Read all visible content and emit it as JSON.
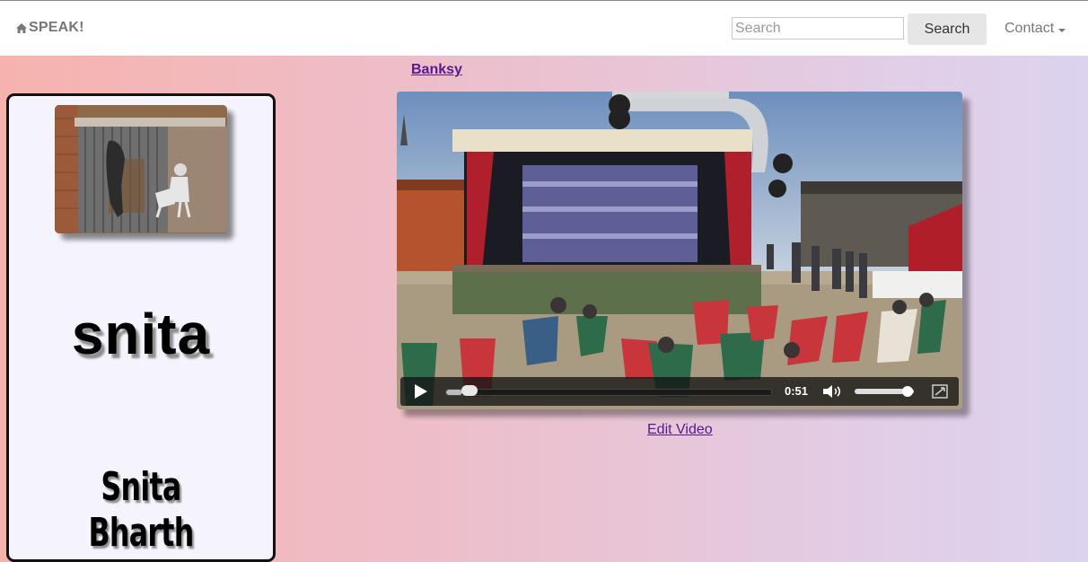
{
  "navbar": {
    "brand": "SPEAK!",
    "brand_icon": "home-icon",
    "search_placeholder": "Search",
    "search_value": "",
    "search_button": "Search",
    "contact_label": "Contact",
    "contact_icon": "caret-down-icon"
  },
  "main": {
    "title_link": "Banksy",
    "edit_link": "Edit Video"
  },
  "profile": {
    "username": "snita",
    "full_name": "Snita Bharth"
  },
  "video": {
    "time": "0:51",
    "progress_fraction": 0.05,
    "volume_fraction": 0.9
  },
  "colors": {
    "link": "#551a8b",
    "gradient_start": "#f6b3ad",
    "gradient_end": "#dcd3ee"
  }
}
